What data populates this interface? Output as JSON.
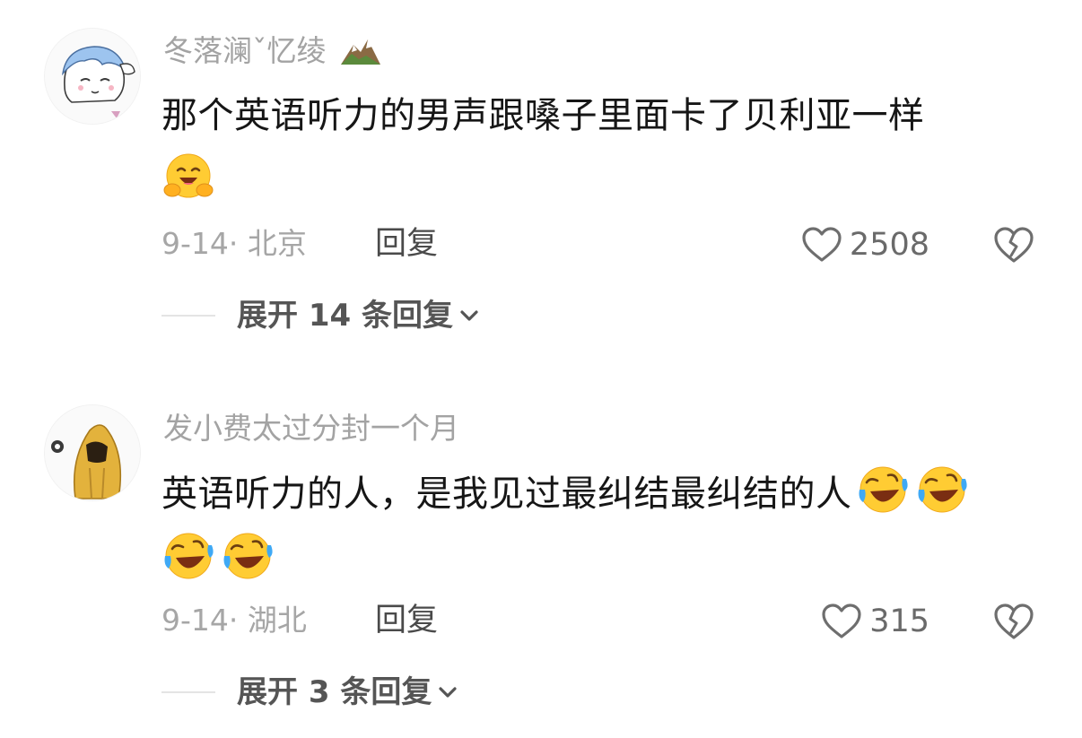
{
  "comments": [
    {
      "username": "冬落澜ˇ忆绫",
      "username_icon": "mountain-emoji",
      "text": "那个英语听力的男声跟嗓子里面卡了贝利亚一样",
      "emojis": [
        "hugging-face-emoji"
      ],
      "date_location": "9-14· 北京",
      "reply_label": "回复",
      "likes": "2508",
      "expand_label": "展开 14 条回复"
    },
    {
      "username": "发小费太过分封一个月",
      "text": "英语听力的人，是我见过最纠结最纠结的人",
      "emojis": [
        "rolling-laughing-emoji",
        "rolling-laughing-emoji",
        "rolling-laughing-emoji",
        "rolling-laughing-emoji"
      ],
      "date_location": "9-14· 湖北",
      "reply_label": "回复",
      "likes": "315",
      "expand_label": "展开 3 条回复"
    }
  ],
  "colors": {
    "username": "#a3a3a3",
    "text": "#161616",
    "meta": "#a6a6a6",
    "accent_gray": "#555555"
  }
}
